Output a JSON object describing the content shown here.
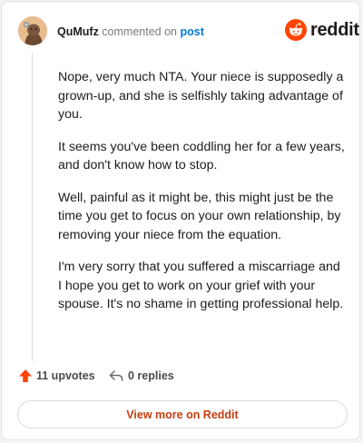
{
  "header": {
    "username": "QuMufz",
    "action": " commented on ",
    "post_link": "post",
    "brand": "reddit"
  },
  "comment": {
    "paragraphs": [
      "Nope, very much NTA. Your niece is supposedly a grown-up, and she is selfishly taking advantage of you.",
      "It seems you've been coddling her for a few years, and don't know how to stop.",
      "Well, painful as it might be, this might just be the time you get to focus on your own relationship, by removing your niece from the equation.",
      "I'm very sorry that you suffered a miscarriage and I hope you get to work on your grief with your spouse. It's no shame in getting professional help."
    ]
  },
  "footer": {
    "upvotes": "11 upvotes",
    "replies": "0 replies",
    "view_more": "View more on Reddit"
  },
  "colors": {
    "brand": "#ff4500",
    "link": "#0079d3",
    "view_more": "#c63d10"
  },
  "icons": [
    "avatar",
    "reddit-logo-icon",
    "upvote-icon",
    "reply-icon"
  ]
}
